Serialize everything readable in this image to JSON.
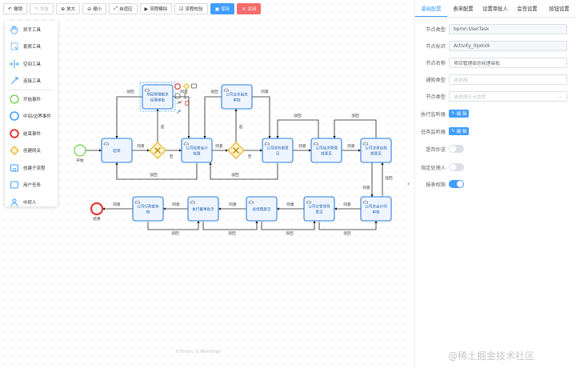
{
  "toolbar": {
    "buttons": [
      {
        "icon": "undo-icon",
        "glyph": "↶",
        "label": "撤销",
        "state": "enabled"
      },
      {
        "icon": "redo-icon",
        "glyph": "↷",
        "label": "恢复",
        "state": "disabled"
      },
      {
        "icon": "zoom-in-icon",
        "glyph": "⊕",
        "label": "放大",
        "state": "enabled"
      },
      {
        "icon": "zoom-out-icon",
        "glyph": "⊖",
        "label": "缩小",
        "state": "enabled"
      },
      {
        "icon": "fit-icon",
        "glyph": "⤢",
        "label": "自适应",
        "state": "enabled"
      },
      {
        "icon": "play-icon",
        "glyph": "▶",
        "label": "流程模拟",
        "state": "enabled"
      },
      {
        "icon": "check-icon",
        "glyph": "☑",
        "label": "流程校验",
        "state": "enabled"
      },
      {
        "icon": "save-icon",
        "glyph": "▣",
        "label": "保存",
        "state": "primary"
      },
      {
        "icon": "close-icon",
        "glyph": "✕",
        "label": "关闭",
        "state": "danger"
      }
    ]
  },
  "palette": {
    "tools": [
      {
        "label": "抓手工具",
        "icon": "hand-tool-icon"
      },
      {
        "label": "套索工具",
        "icon": "lasso-tool-icon"
      },
      {
        "label": "空间工具",
        "icon": "space-tool-icon"
      },
      {
        "label": "连接工具",
        "icon": "connect-tool-icon"
      }
    ],
    "elements": [
      {
        "label": "开始事件",
        "icon": "start-event-icon"
      },
      {
        "label": "中间/边界事件",
        "icon": "intermediate-event-icon"
      },
      {
        "label": "结束事件",
        "icon": "end-event-icon"
      },
      {
        "label": "创建网关",
        "icon": "gateway-icon"
      },
      {
        "label": "创建子流程",
        "icon": "subprocess-icon"
      },
      {
        "label": "用户任务",
        "icon": "user-task-icon"
      },
      {
        "label": "中转人",
        "icon": "relay-user-icon"
      }
    ]
  },
  "diagram": {
    "start_label": "开始",
    "end_label": "结束",
    "tasks_top": [
      "项目管理部总经理审批",
      "公司业务副总审批"
    ],
    "tasks_main": [
      "起草",
      "公司经营会计核算",
      "公司财务部意见",
      "公司经济管理部意见",
      "公司法律合规部意见"
    ],
    "tasks_bottom": [
      "公司总会计师审核",
      "公司分管领导意见",
      "总经理意见",
      "执行董事批示",
      "公司行政部存档"
    ],
    "flow_labels": {
      "approve": "同意",
      "reject": "驳回",
      "yes": "是",
      "no": "否"
    }
  },
  "footer_status": "0 Errors, 0 Warnings",
  "watermark": "@稀土掘金技术社区",
  "panel": {
    "collapse_glyph": "›",
    "tabs": [
      "基础配置",
      "表单配置",
      "设置审批人",
      "会签设置",
      "按钮设置"
    ],
    "active_tab": "基础配置",
    "node_type_label": "节点类型",
    "node_type_value": "bpmn:UserTask",
    "node_id_label": "节点标识",
    "node_id_value": "Activity_0ijxks9",
    "node_name_label": "节点名称",
    "node_name_value": "项目管理部总经理审批",
    "notify_type_label": "通知类型",
    "notify_type_placeholder": "请选择",
    "node_kind_label": "节点类型",
    "node_kind_placeholder": "请选择节点类型",
    "exec_listener_label": "执行监听器",
    "task_listener_label": "任务监听器",
    "edit_button": "编 辑",
    "auto_cc_label": "是否抄送",
    "auto_cc_on": false,
    "assign_handler_label": "指定处理人",
    "assign_handler_on": false,
    "report_perm_label": "报表权限",
    "report_perm_on": true
  },
  "colors": {
    "accent": "#409eff",
    "danger": "#f56c6c",
    "task_border": "#2a7de1",
    "task_fill": "#eef5ff",
    "gateway_stroke": "#e0a90d",
    "gateway_fill": "#fff3c8",
    "start_stroke": "#52c41a",
    "end_stroke": "#e53935"
  }
}
